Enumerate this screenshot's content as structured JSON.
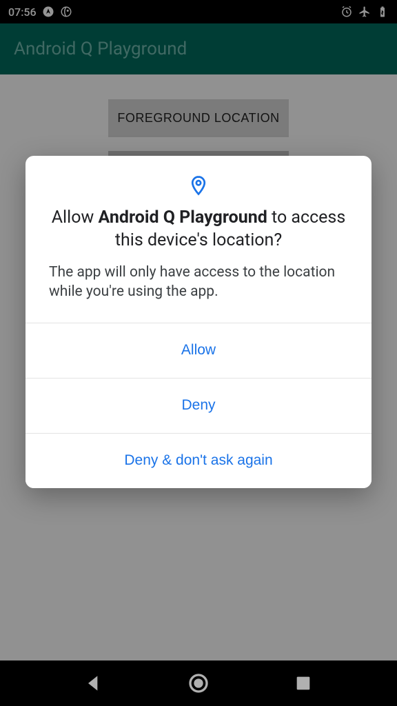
{
  "status": {
    "time": "07:56",
    "icons": {
      "nav_arrow": "navigation-icon",
      "system": "system-icon",
      "alarm": "alarm-icon",
      "airplane": "airplane-icon",
      "battery": "battery-charging-icon"
    }
  },
  "app_bar": {
    "title": "Android Q Playground"
  },
  "main": {
    "buttons": [
      {
        "label": "FOREGROUND LOCATION"
      }
    ]
  },
  "dialog": {
    "icon": "location-pin-icon",
    "title_prefix": "Allow ",
    "title_app": "Android Q Playground",
    "title_suffix": " to access this device's location?",
    "body": "The app will only have access to the location while you're using the app.",
    "actions": {
      "allow": "Allow",
      "deny": "Deny",
      "deny_forever": "Deny & don't ask again"
    }
  }
}
